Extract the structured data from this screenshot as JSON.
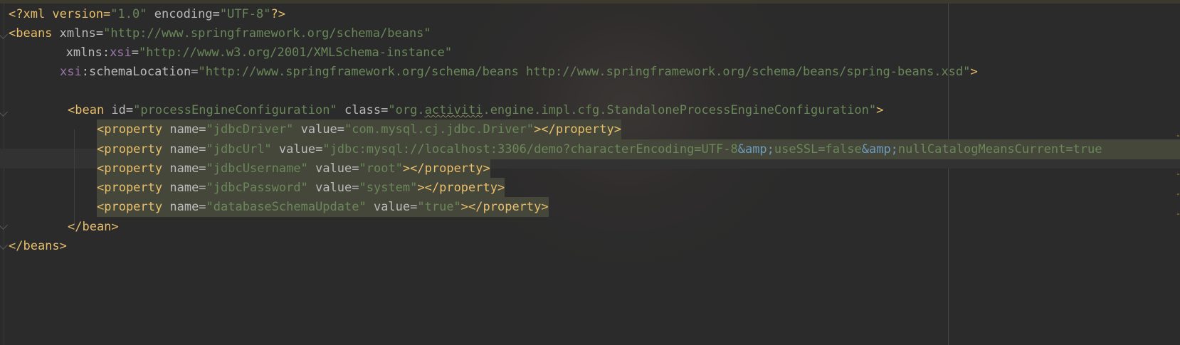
{
  "editor": {
    "language": "XML",
    "lines": [
      {
        "tokens": [
          "<?xml version=",
          "\"1.0\"",
          " encoding=",
          "\"UTF-8\"",
          "?>"
        ]
      },
      {
        "tokens": [
          "<beans",
          " xmlns=",
          "\"http://www.springframework.org/schema/beans\""
        ]
      },
      {
        "tokens": [
          "       xmlns:",
          "xsi",
          "=",
          "\"http://www.w3.org/2001/XMLSchema-instance\""
        ]
      },
      {
        "tokens": [
          "xsi",
          ":schemaLocation=",
          "\"http://www.springframework.org/schema/beans http://www.springframework.org/schema/beans/spring-beans.xsd\"",
          ">"
        ]
      },
      {
        "tokens": []
      },
      {
        "tokens": [
          "<bean",
          " id=",
          "\"processEngineConfiguration\"",
          " class=",
          "\"org.",
          "activiti",
          ".engine.impl.cfg.StandaloneProcessEngineConfiguration\"",
          ">"
        ]
      },
      {
        "tokens": [
          "<property",
          " name=",
          "\"jdbcDriver\"",
          " value=",
          "\"com.mysql.cj.jdbc.Driver\"",
          "></property>"
        ]
      },
      {
        "tokens": [
          "<property",
          " name=",
          "\"jdbcUrl\"",
          " value=",
          "\"jdbc:mysql://localhost:3306/demo?characterEncoding=UTF-8",
          "&amp;",
          "useSSL=false",
          "&amp;",
          "nullCatalogMeansCurrent=true"
        ]
      },
      {
        "tokens": [
          "<property",
          " name=",
          "\"jdbcUsername\"",
          " value=",
          "\"root\"",
          "></property>"
        ]
      },
      {
        "tokens": [
          "<property",
          " name=",
          "\"jdbcPassword\"",
          " value=",
          "\"system\"",
          "></property>"
        ]
      },
      {
        "tokens": [
          "<property",
          " name=",
          "\"databaseSchemaUpdate\"",
          " value=",
          "\"true\"",
          "></property>"
        ]
      },
      {
        "tokens": [
          "</bean>"
        ]
      },
      {
        "tokens": [
          "</beans>"
        ]
      }
    ]
  },
  "colors": {
    "background": "#2b2b2b",
    "tag": "#e8bf6a",
    "attribute": "#bababa",
    "namespace": "#9876aa",
    "string": "#6a8759",
    "entity": "#6d9cbe",
    "selection": "#46473b"
  }
}
